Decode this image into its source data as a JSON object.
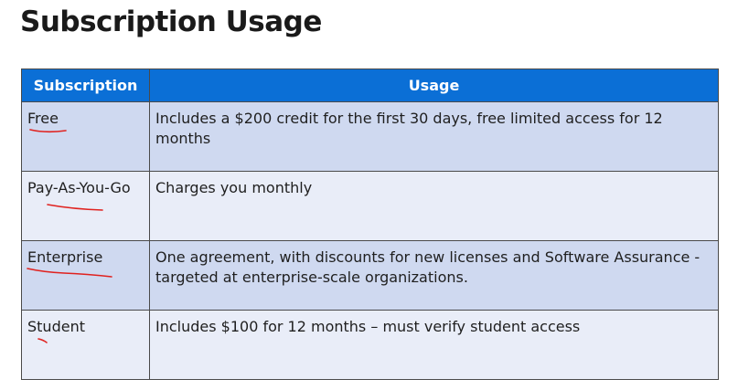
{
  "title": "Subscription Usage",
  "table": {
    "headers": {
      "subscription": "Subscription",
      "usage": "Usage"
    },
    "rows": [
      {
        "subscription": "Free",
        "usage": "Includes a $200 credit for the first 30 days, free limited access for 12 months"
      },
      {
        "subscription": "Pay-As-You-Go",
        "usage": "Charges you monthly"
      },
      {
        "subscription": "Enterprise",
        "usage": "One agreement, with discounts for new licenses and Software Assurance - targeted at enterprise-scale organizations."
      },
      {
        "subscription": "Student",
        "usage": "Includes $100 for 12 months – must verify student access"
      }
    ]
  },
  "colors": {
    "header_bg": "#0b6fd6",
    "row_odd_bg": "#cfd9f0",
    "row_even_bg": "#e9edf8",
    "annotation_ink": "#e0221f"
  }
}
